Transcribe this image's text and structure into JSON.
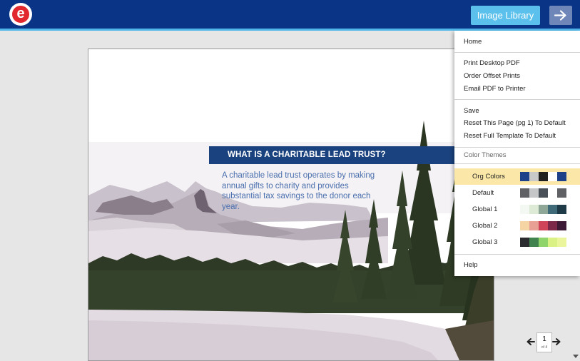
{
  "header": {
    "logo_letter": "e",
    "image_library_label": "Image Library",
    "next_icon": "arrow-right-icon"
  },
  "document": {
    "title": "WHAT IS A CHARITABLE LEAD TRUST?",
    "body": "A charitable lead trust operates by making annual gifts to charity and provides substantial tax savings to the donor each year."
  },
  "menu": {
    "home": "Home",
    "print_desktop_pdf": "Print Desktop PDF",
    "order_offset_prints": "Order Offset Prints",
    "email_pdf": "Email PDF to Printer",
    "save": "Save",
    "reset_page": "Reset This Page (pg 1) To Default",
    "reset_template": "Reset Full Template To Default",
    "color_themes_label": "Color Themes",
    "themes": [
      {
        "name": "Org Colors",
        "selected": true,
        "colors": [
          "#1d4189",
          "#c9c9c9",
          "#1f1f1f",
          "#ffffff",
          "#1d4189"
        ]
      },
      {
        "name": "Default",
        "selected": false,
        "colors": [
          "#5f6063",
          "#c4c6c8",
          "#4a5058",
          "#ffffff",
          "#5f6063"
        ]
      },
      {
        "name": "Global 1",
        "selected": false,
        "colors": [
          "#f4f8f2",
          "#dcead6",
          "#8ea797",
          "#3f6a78",
          "#1d3a46"
        ]
      },
      {
        "name": "Global 2",
        "selected": false,
        "colors": [
          "#f6d5a5",
          "#e8a094",
          "#cf4459",
          "#7c2949",
          "#3c1a35"
        ]
      },
      {
        "name": "Global 3",
        "selected": false,
        "colors": [
          "#2a2b2f",
          "#41834e",
          "#8fd36b",
          "#d9f185",
          "#ebf59c"
        ]
      }
    ],
    "help": "Help"
  },
  "pager": {
    "current": "1",
    "of": "of 4"
  }
}
